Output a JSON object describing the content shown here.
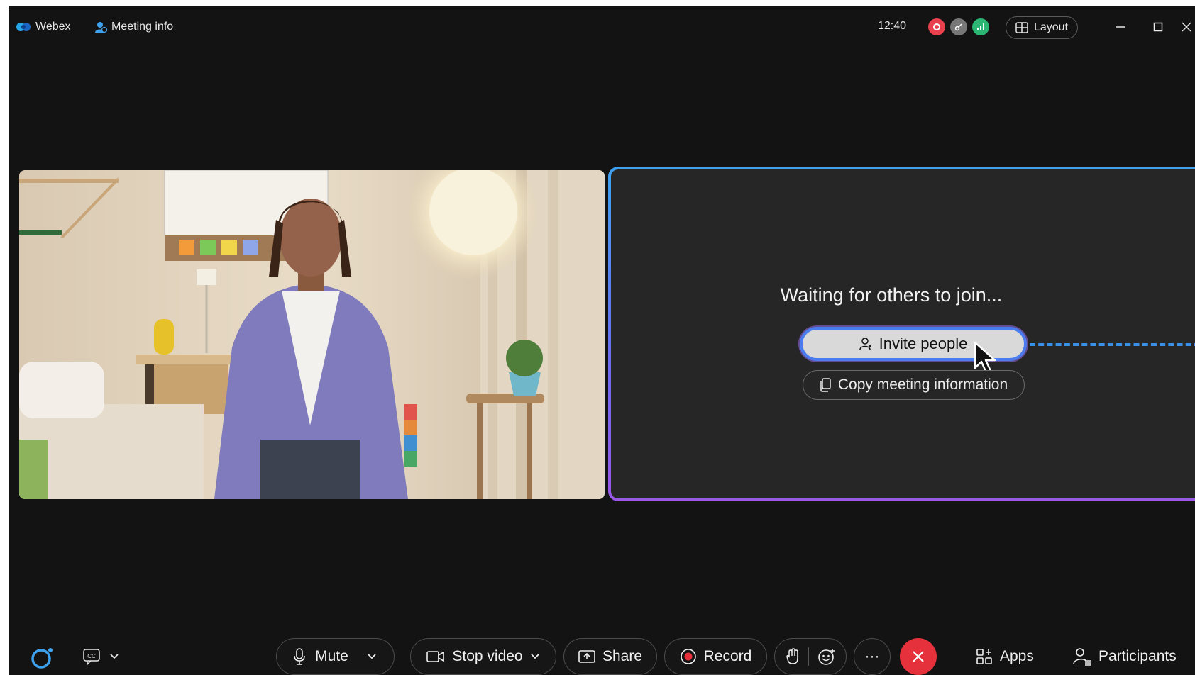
{
  "titlebar": {
    "app_name": "Webex",
    "meeting_info": "Meeting info",
    "time": "12:40",
    "layout_label": "Layout"
  },
  "colors": {
    "accent_blue": "#3ea1ee",
    "accent_purple": "#9a58e6",
    "end_red": "#e5313b",
    "record_red": "#e5313b"
  },
  "stage": {
    "waiting_message": "Waiting for others to join...",
    "invite_label": "Invite people",
    "copy_label": "Copy meeting information"
  },
  "toolbar": {
    "mute_label": "Mute",
    "stop_video_label": "Stop video",
    "share_label": "Share",
    "record_label": "Record",
    "more_label": "···",
    "apps_label": "Apps",
    "participants_label": "Participants"
  }
}
